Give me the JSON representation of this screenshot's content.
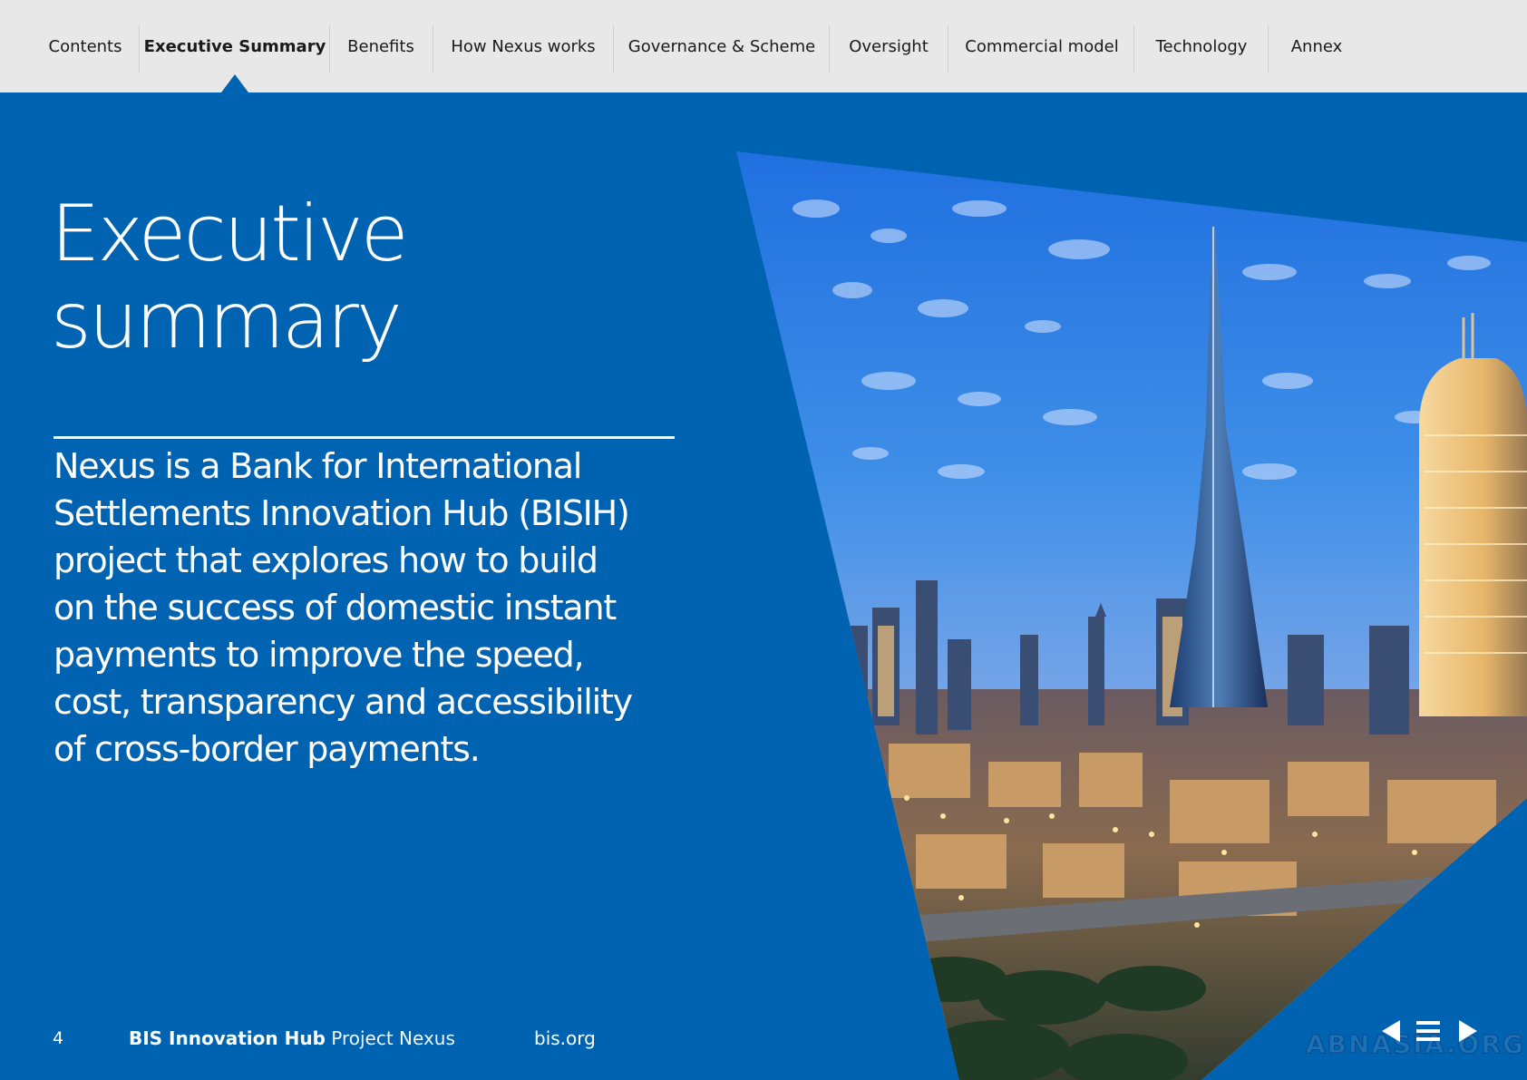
{
  "nav": {
    "items": [
      {
        "label": "Contents"
      },
      {
        "label": "Executive Summary"
      },
      {
        "label": "Benefits"
      },
      {
        "label": "How Nexus works"
      },
      {
        "label": "Governance & Scheme"
      },
      {
        "label": "Oversight"
      },
      {
        "label": "Commercial model"
      },
      {
        "label": "Technology"
      },
      {
        "label": "Annex"
      }
    ],
    "active": "Executive Summary"
  },
  "page": {
    "title_line1": "Executive",
    "title_line2": "summary",
    "lead": "Nexus is a Bank for International Settlements Innovation Hub (BISIH) project that explores how to build on the success of domestic instant payments to improve the speed, cost, transparency and accessibility of cross-border payments."
  },
  "footer": {
    "page_number": "4",
    "publisher": "BIS Innovation Hub",
    "project": "Project Nexus",
    "site": "bis.org"
  },
  "controls": {
    "prev_icon": "triangle-left-icon",
    "menu_icon": "hamburger-menu-icon",
    "next_icon": "triangle-right-icon"
  },
  "watermark": "ABNASIA.ORG",
  "colors": {
    "background": "#0063b1",
    "nav_background": "#e8e8e8",
    "text": "#ffffff"
  }
}
